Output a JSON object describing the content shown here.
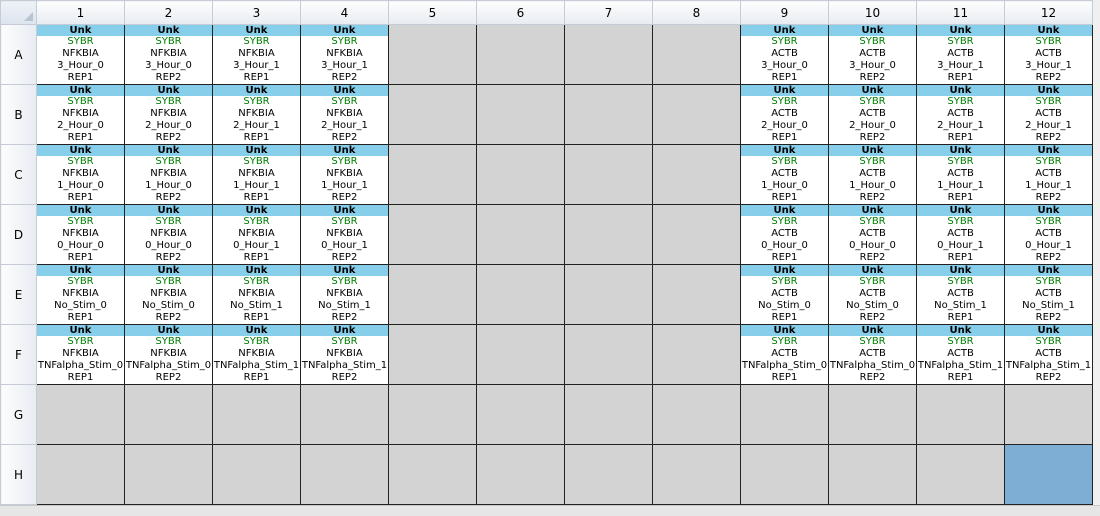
{
  "columns": [
    "1",
    "2",
    "3",
    "4",
    "5",
    "6",
    "7",
    "8",
    "9",
    "10",
    "11",
    "12"
  ],
  "rows": [
    {
      "label": "A",
      "wells": [
        {
          "task": "Unk",
          "dye": "SYBR",
          "target": "NFKBIA",
          "sample": "3_Hour_0",
          "rep": "REP1"
        },
        {
          "task": "Unk",
          "dye": "SYBR",
          "target": "NFKBIA",
          "sample": "3_Hour_0",
          "rep": "REP2"
        },
        {
          "task": "Unk",
          "dye": "SYBR",
          "target": "NFKBIA",
          "sample": "3_Hour_1",
          "rep": "REP1"
        },
        {
          "task": "Unk",
          "dye": "SYBR",
          "target": "NFKBIA",
          "sample": "3_Hour_1",
          "rep": "REP2"
        },
        null,
        null,
        null,
        null,
        {
          "task": "Unk",
          "dye": "SYBR",
          "target": "ACTB",
          "sample": "3_Hour_0",
          "rep": "REP1"
        },
        {
          "task": "Unk",
          "dye": "SYBR",
          "target": "ACTB",
          "sample": "3_Hour_0",
          "rep": "REP2"
        },
        {
          "task": "Unk",
          "dye": "SYBR",
          "target": "ACTB",
          "sample": "3_Hour_1",
          "rep": "REP1"
        },
        {
          "task": "Unk",
          "dye": "SYBR",
          "target": "ACTB",
          "sample": "3_Hour_1",
          "rep": "REP2"
        }
      ]
    },
    {
      "label": "B",
      "wells": [
        {
          "task": "Unk",
          "dye": "SYBR",
          "target": "NFKBIA",
          "sample": "2_Hour_0",
          "rep": "REP1"
        },
        {
          "task": "Unk",
          "dye": "SYBR",
          "target": "NFKBIA",
          "sample": "2_Hour_0",
          "rep": "REP2"
        },
        {
          "task": "Unk",
          "dye": "SYBR",
          "target": "NFKBIA",
          "sample": "2_Hour_1",
          "rep": "REP1"
        },
        {
          "task": "Unk",
          "dye": "SYBR",
          "target": "NFKBIA",
          "sample": "2_Hour_1",
          "rep": "REP2"
        },
        null,
        null,
        null,
        null,
        {
          "task": "Unk",
          "dye": "SYBR",
          "target": "ACTB",
          "sample": "2_Hour_0",
          "rep": "REP1"
        },
        {
          "task": "Unk",
          "dye": "SYBR",
          "target": "ACTB",
          "sample": "2_Hour_0",
          "rep": "REP2"
        },
        {
          "task": "Unk",
          "dye": "SYBR",
          "target": "ACTB",
          "sample": "2_Hour_1",
          "rep": "REP1"
        },
        {
          "task": "Unk",
          "dye": "SYBR",
          "target": "ACTB",
          "sample": "2_Hour_1",
          "rep": "REP2"
        }
      ]
    },
    {
      "label": "C",
      "wells": [
        {
          "task": "Unk",
          "dye": "SYBR",
          "target": "NFKBIA",
          "sample": "1_Hour_0",
          "rep": "REP1"
        },
        {
          "task": "Unk",
          "dye": "SYBR",
          "target": "NFKBIA",
          "sample": "1_Hour_0",
          "rep": "REP2"
        },
        {
          "task": "Unk",
          "dye": "SYBR",
          "target": "NFKBIA",
          "sample": "1_Hour_1",
          "rep": "REP1"
        },
        {
          "task": "Unk",
          "dye": "SYBR",
          "target": "NFKBIA",
          "sample": "1_Hour_1",
          "rep": "REP2"
        },
        null,
        null,
        null,
        null,
        {
          "task": "Unk",
          "dye": "SYBR",
          "target": "ACTB",
          "sample": "1_Hour_0",
          "rep": "REP1"
        },
        {
          "task": "Unk",
          "dye": "SYBR",
          "target": "ACTB",
          "sample": "1_Hour_0",
          "rep": "REP2"
        },
        {
          "task": "Unk",
          "dye": "SYBR",
          "target": "ACTB",
          "sample": "1_Hour_1",
          "rep": "REP1"
        },
        {
          "task": "Unk",
          "dye": "SYBR",
          "target": "ACTB",
          "sample": "1_Hour_1",
          "rep": "REP2"
        }
      ]
    },
    {
      "label": "D",
      "wells": [
        {
          "task": "Unk",
          "dye": "SYBR",
          "target": "NFKBIA",
          "sample": "0_Hour_0",
          "rep": "REP1"
        },
        {
          "task": "Unk",
          "dye": "SYBR",
          "target": "NFKBIA",
          "sample": "0_Hour_0",
          "rep": "REP2"
        },
        {
          "task": "Unk",
          "dye": "SYBR",
          "target": "NFKBIA",
          "sample": "0_Hour_1",
          "rep": "REP1"
        },
        {
          "task": "Unk",
          "dye": "SYBR",
          "target": "NFKBIA",
          "sample": "0_Hour_1",
          "rep": "REP2"
        },
        null,
        null,
        null,
        null,
        {
          "task": "Unk",
          "dye": "SYBR",
          "target": "ACTB",
          "sample": "0_Hour_0",
          "rep": "REP1"
        },
        {
          "task": "Unk",
          "dye": "SYBR",
          "target": "ACTB",
          "sample": "0_Hour_0",
          "rep": "REP2"
        },
        {
          "task": "Unk",
          "dye": "SYBR",
          "target": "ACTB",
          "sample": "0_Hour_1",
          "rep": "REP1"
        },
        {
          "task": "Unk",
          "dye": "SYBR",
          "target": "ACTB",
          "sample": "0_Hour_1",
          "rep": "REP2"
        }
      ]
    },
    {
      "label": "E",
      "wells": [
        {
          "task": "Unk",
          "dye": "SYBR",
          "target": "NFKBIA",
          "sample": "No_Stim_0",
          "rep": "REP1"
        },
        {
          "task": "Unk",
          "dye": "SYBR",
          "target": "NFKBIA",
          "sample": "No_Stim_0",
          "rep": "REP2"
        },
        {
          "task": "Unk",
          "dye": "SYBR",
          "target": "NFKBIA",
          "sample": "No_Stim_1",
          "rep": "REP1"
        },
        {
          "task": "Unk",
          "dye": "SYBR",
          "target": "NFKBIA",
          "sample": "No_Stim_1",
          "rep": "REP2"
        },
        null,
        null,
        null,
        null,
        {
          "task": "Unk",
          "dye": "SYBR",
          "target": "ACTB",
          "sample": "No_Stim_0",
          "rep": "REP1"
        },
        {
          "task": "Unk",
          "dye": "SYBR",
          "target": "ACTB",
          "sample": "No_Stim_0",
          "rep": "REP2"
        },
        {
          "task": "Unk",
          "dye": "SYBR",
          "target": "ACTB",
          "sample": "No_Stim_1",
          "rep": "REP1"
        },
        {
          "task": "Unk",
          "dye": "SYBR",
          "target": "ACTB",
          "sample": "No_Stim_1",
          "rep": "REP2"
        }
      ]
    },
    {
      "label": "F",
      "wells": [
        {
          "task": "Unk",
          "dye": "SYBR",
          "target": "NFKBIA",
          "sample": "TNFalpha_Stim_0",
          "rep": "REP1"
        },
        {
          "task": "Unk",
          "dye": "SYBR",
          "target": "NFKBIA",
          "sample": "TNFalpha_Stim_0",
          "rep": "REP2"
        },
        {
          "task": "Unk",
          "dye": "SYBR",
          "target": "NFKBIA",
          "sample": "TNFalpha_Stim_1",
          "rep": "REP1"
        },
        {
          "task": "Unk",
          "dye": "SYBR",
          "target": "NFKBIA",
          "sample": "TNFalpha_Stim_1",
          "rep": "REP2"
        },
        null,
        null,
        null,
        null,
        {
          "task": "Unk",
          "dye": "SYBR",
          "target": "ACTB",
          "sample": "TNFalpha_Stim_0",
          "rep": "REP1"
        },
        {
          "task": "Unk",
          "dye": "SYBR",
          "target": "ACTB",
          "sample": "TNFalpha_Stim_0",
          "rep": "REP2"
        },
        {
          "task": "Unk",
          "dye": "SYBR",
          "target": "ACTB",
          "sample": "TNFalpha_Stim_1",
          "rep": "REP1"
        },
        {
          "task": "Unk",
          "dye": "SYBR",
          "target": "ACTB",
          "sample": "TNFalpha_Stim_1",
          "rep": "REP2"
        }
      ]
    },
    {
      "label": "G",
      "wells": [
        null,
        null,
        null,
        null,
        null,
        null,
        null,
        null,
        null,
        null,
        null,
        null
      ]
    },
    {
      "label": "H",
      "wells": [
        null,
        null,
        null,
        null,
        null,
        null,
        null,
        null,
        null,
        null,
        null,
        null
      ]
    }
  ],
  "selected_well": "H12",
  "colors": {
    "task_band": "#87ceeb",
    "dye_text": "#008000",
    "empty_well": "#d3d3d3",
    "selected_well": "#7eaed4"
  }
}
